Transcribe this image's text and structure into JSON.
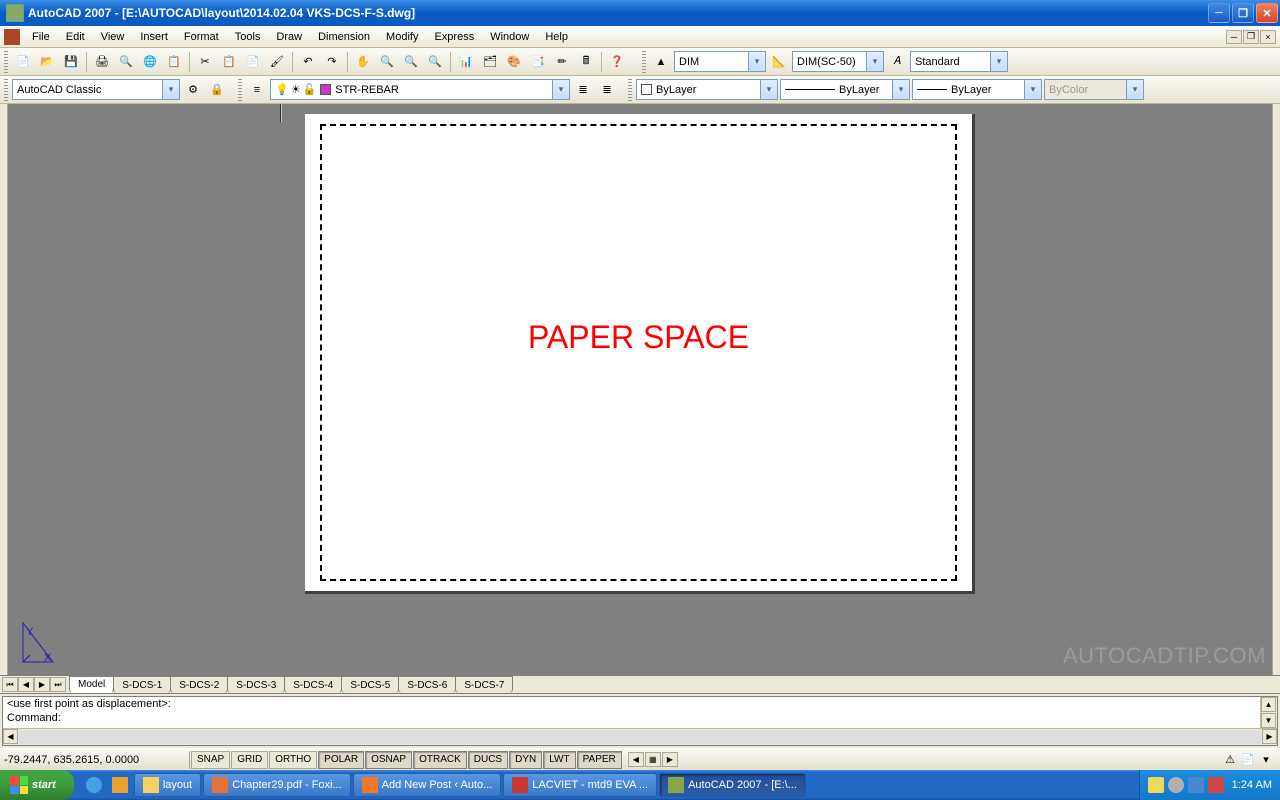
{
  "title": "AutoCAD 2007 - [E:\\AUTOCAD\\layout\\2014.02.04 VKS-DCS-F-S.dwg]",
  "menus": [
    "File",
    "Edit",
    "View",
    "Insert",
    "Format",
    "Tools",
    "Draw",
    "Dimension",
    "Modify",
    "Express",
    "Window",
    "Help"
  ],
  "toolbar": {
    "workspace": "AutoCAD Classic",
    "layer": "STR-REBAR",
    "dim_style": "DIM",
    "dim_sc": "DIM(SC-50)",
    "text_style": "Standard",
    "color": "ByLayer",
    "linetype": "ByLayer",
    "lineweight": "ByLayer",
    "plotstyle": "ByColor"
  },
  "canvas": {
    "label": "PAPER SPACE",
    "watermark": "AUTOCADTIP.COM"
  },
  "tabs": [
    "Model",
    "S-DCS-1",
    "S-DCS-2",
    "S-DCS-3",
    "S-DCS-4",
    "S-DCS-5",
    "S-DCS-6",
    "S-DCS-7"
  ],
  "active_tab": 0,
  "command": {
    "line1": "<use first point as displacement>:",
    "line2": "Command:"
  },
  "status": {
    "coords": "-79.2447, 635.2615, 0.0000",
    "toggles": [
      "SNAP",
      "GRID",
      "ORTHO",
      "POLAR",
      "OSNAP",
      "OTRACK",
      "DUCS",
      "DYN",
      "LWT",
      "PAPER"
    ],
    "pressed": [
      "POLAR",
      "OSNAP",
      "OTRACK",
      "DUCS",
      "DYN",
      "LWT",
      "PAPER"
    ]
  },
  "taskbar": {
    "start": "start",
    "items": [
      {
        "label": "layout",
        "icon": "#f8d060"
      },
      {
        "label": "Chapter29.pdf - Foxi...",
        "icon": "#e87030"
      },
      {
        "label": "Add New Post ‹ Auto...",
        "icon": "#f07828"
      },
      {
        "label": "LACVIET - mtd9 EVA ...",
        "icon": "#c83838"
      },
      {
        "label": "AutoCAD 2007 - [E:\\...",
        "icon": "#88a848",
        "active": true
      }
    ],
    "clock": "1:24 AM"
  }
}
